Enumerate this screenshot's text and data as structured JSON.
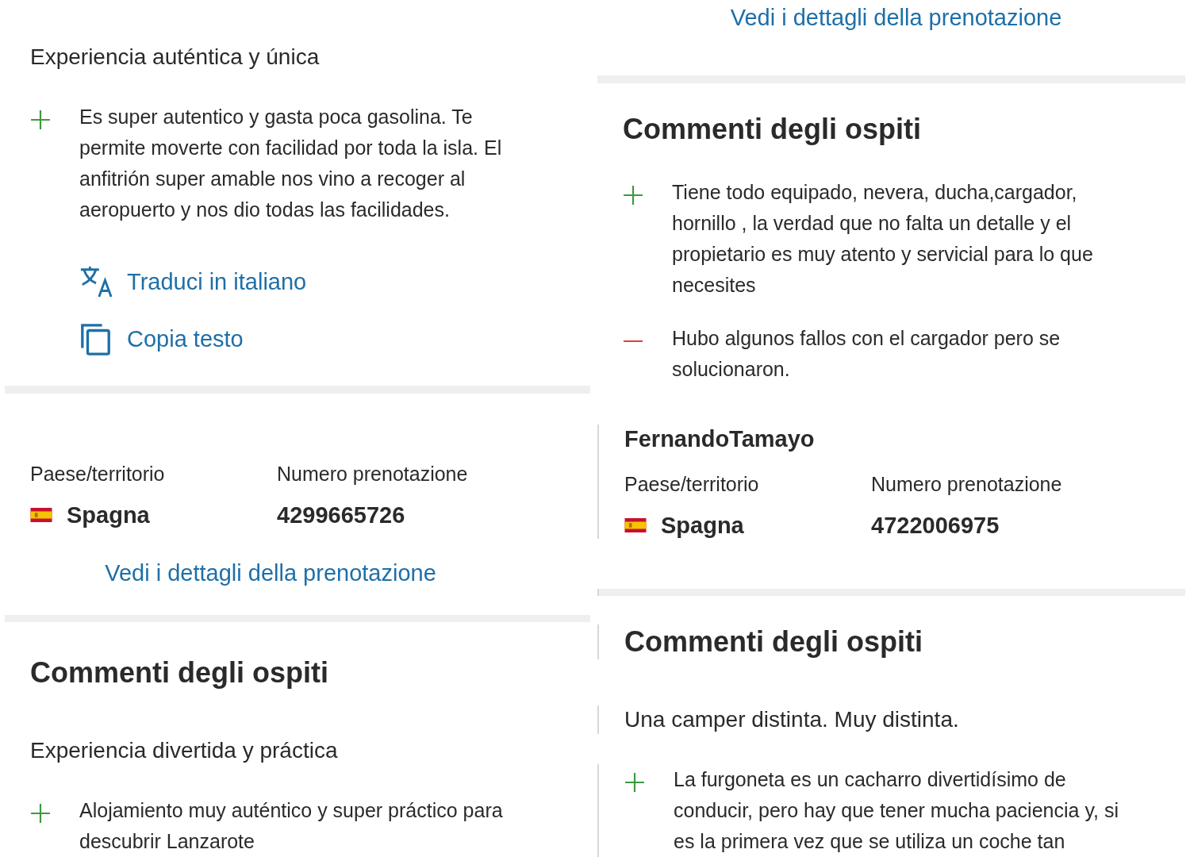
{
  "columns": [
    {
      "blocks": [
        {
          "kind": "subtitle",
          "text": "Experiencia auténtica y única"
        },
        {
          "kind": "pro",
          "text": "Es super autentico y gasta poca gasolina. Te permite moverte con facilidad por toda la isla. El anfitrión super amable nos vino a recoger al aeropuerto y nos dio todas las facilidades."
        },
        {
          "kind": "translate",
          "label": "Traduci in italiano"
        },
        {
          "kind": "copy",
          "label": "Copia testo"
        },
        {
          "kind": "divider"
        },
        {
          "kind": "booking",
          "country_label": "Paese/territorio",
          "country": "Spagna",
          "number_label": "Numero prenotazione",
          "number": "4299665726",
          "link": "Vedi i dettagli della prenotazione"
        },
        {
          "kind": "divider"
        },
        {
          "kind": "heading",
          "text": "Commenti degli ospiti"
        },
        {
          "kind": "subtitle",
          "text": "Experiencia divertida y práctica"
        },
        {
          "kind": "pro",
          "text": "Alojamiento muy auténtico y super práctico para descubrir Lanzarote"
        }
      ]
    },
    {
      "blocks": [
        {
          "kind": "link",
          "text": "Vedi i dettagli della prenotazione"
        },
        {
          "kind": "divider"
        },
        {
          "kind": "heading",
          "text": "Commenti degli ospiti"
        },
        {
          "kind": "pro",
          "text": "Tiene todo equipado, nevera, ducha,cargador, hornillo , la verdad que no falta un detalle y el propietario es muy atento y servicial para lo que necesites"
        },
        {
          "kind": "con",
          "text": "Hubo algunos fallos con el cargador pero se solucionaron."
        },
        {
          "kind": "booking",
          "guest": "FernandoTamayo",
          "country_label": "Paese/territorio",
          "country": "Spagna",
          "number_label": "Numero prenotazione",
          "number": "4722006975"
        },
        {
          "kind": "divider"
        },
        {
          "kind": "heading",
          "text": "Commenti degli ospiti"
        },
        {
          "kind": "subtitle",
          "text": "Una camper distinta. Muy distinta."
        },
        {
          "kind": "pro",
          "text": "La furgoneta es un cacharro divertidísimo de conducir, pero hay que tener mucha paciencia y, si es la primera vez que se utiliza un coche tan"
        }
      ]
    }
  ]
}
